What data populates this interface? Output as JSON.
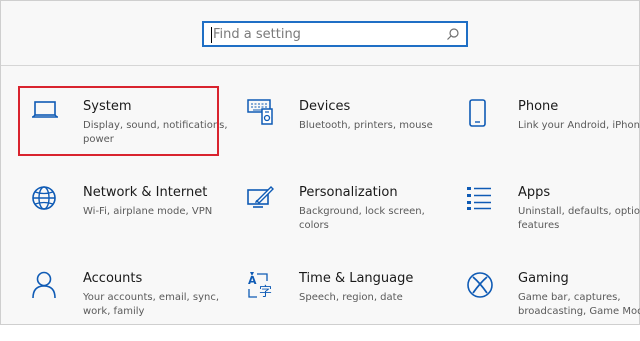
{
  "search": {
    "placeholder": "Find a setting",
    "icon": "search-icon"
  },
  "accent_color": "#0f5bb5",
  "highlight_color": "#d9232e",
  "tiles": [
    {
      "title": "System",
      "desc": "Display, sound, notifications, power",
      "icon": "laptop-icon"
    },
    {
      "title": "Devices",
      "desc": "Bluetooth, printers, mouse",
      "icon": "devices-icon"
    },
    {
      "title": "Phone",
      "desc": "Link your Android, iPhone",
      "icon": "phone-icon"
    },
    {
      "title": "Network & Internet",
      "desc": "Wi-Fi, airplane mode, VPN",
      "icon": "globe-icon"
    },
    {
      "title": "Personalization",
      "desc": "Background, lock screen, colors",
      "icon": "paint-icon"
    },
    {
      "title": "Apps",
      "desc": "Uninstall, defaults, optional features",
      "icon": "apps-list-icon"
    },
    {
      "title": "Accounts",
      "desc": "Your accounts, email, sync, work, family",
      "icon": "person-icon"
    },
    {
      "title": "Time & Language",
      "desc": "Speech, region, date",
      "icon": "time-language-icon"
    },
    {
      "title": "Gaming",
      "desc": "Game bar, captures, broadcasting, Game Mode",
      "icon": "xbox-icon"
    }
  ]
}
